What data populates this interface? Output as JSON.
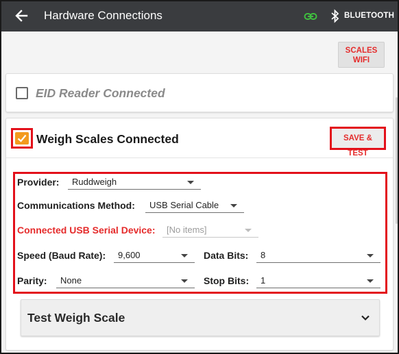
{
  "appbar": {
    "title": "Hardware Connections",
    "bluetooth_label": "BLUETOOTH",
    "back_icon": "arrow-left-icon",
    "link_icon": "link-icon",
    "link_color": "#3fbf3f",
    "bluetooth_icon": "bluetooth-icon"
  },
  "wifi_button": {
    "line1": "SCALES",
    "line2": "WIFI"
  },
  "eid": {
    "label": "EID Reader Connected",
    "checked": false
  },
  "weigh_scales": {
    "label": "Weigh Scales Connected",
    "checked": true,
    "save_label": "SAVE & TEST",
    "provider": {
      "label": "Provider:",
      "value": "Ruddweigh"
    },
    "comm_method": {
      "label": "Communications Method:",
      "value": "USB Serial Cable"
    },
    "usb_device": {
      "label": "Connected USB Serial Device:",
      "value": "[No items]"
    },
    "speed": {
      "label": "Speed (Baud Rate):",
      "value": "9,600"
    },
    "data_bits": {
      "label": "Data Bits:",
      "value": "8"
    },
    "parity": {
      "label": "Parity:",
      "value": "None"
    },
    "stop_bits": {
      "label": "Stop Bits:",
      "value": "1"
    }
  },
  "test_panel": {
    "label": "Test Weigh Scale",
    "chevron_icon": "chevron-down-icon"
  },
  "colors": {
    "accent": "#e52b2b",
    "appbar": "#3a3c3f",
    "checkbox": "#f39a1e",
    "highlight": "#e3101a"
  }
}
